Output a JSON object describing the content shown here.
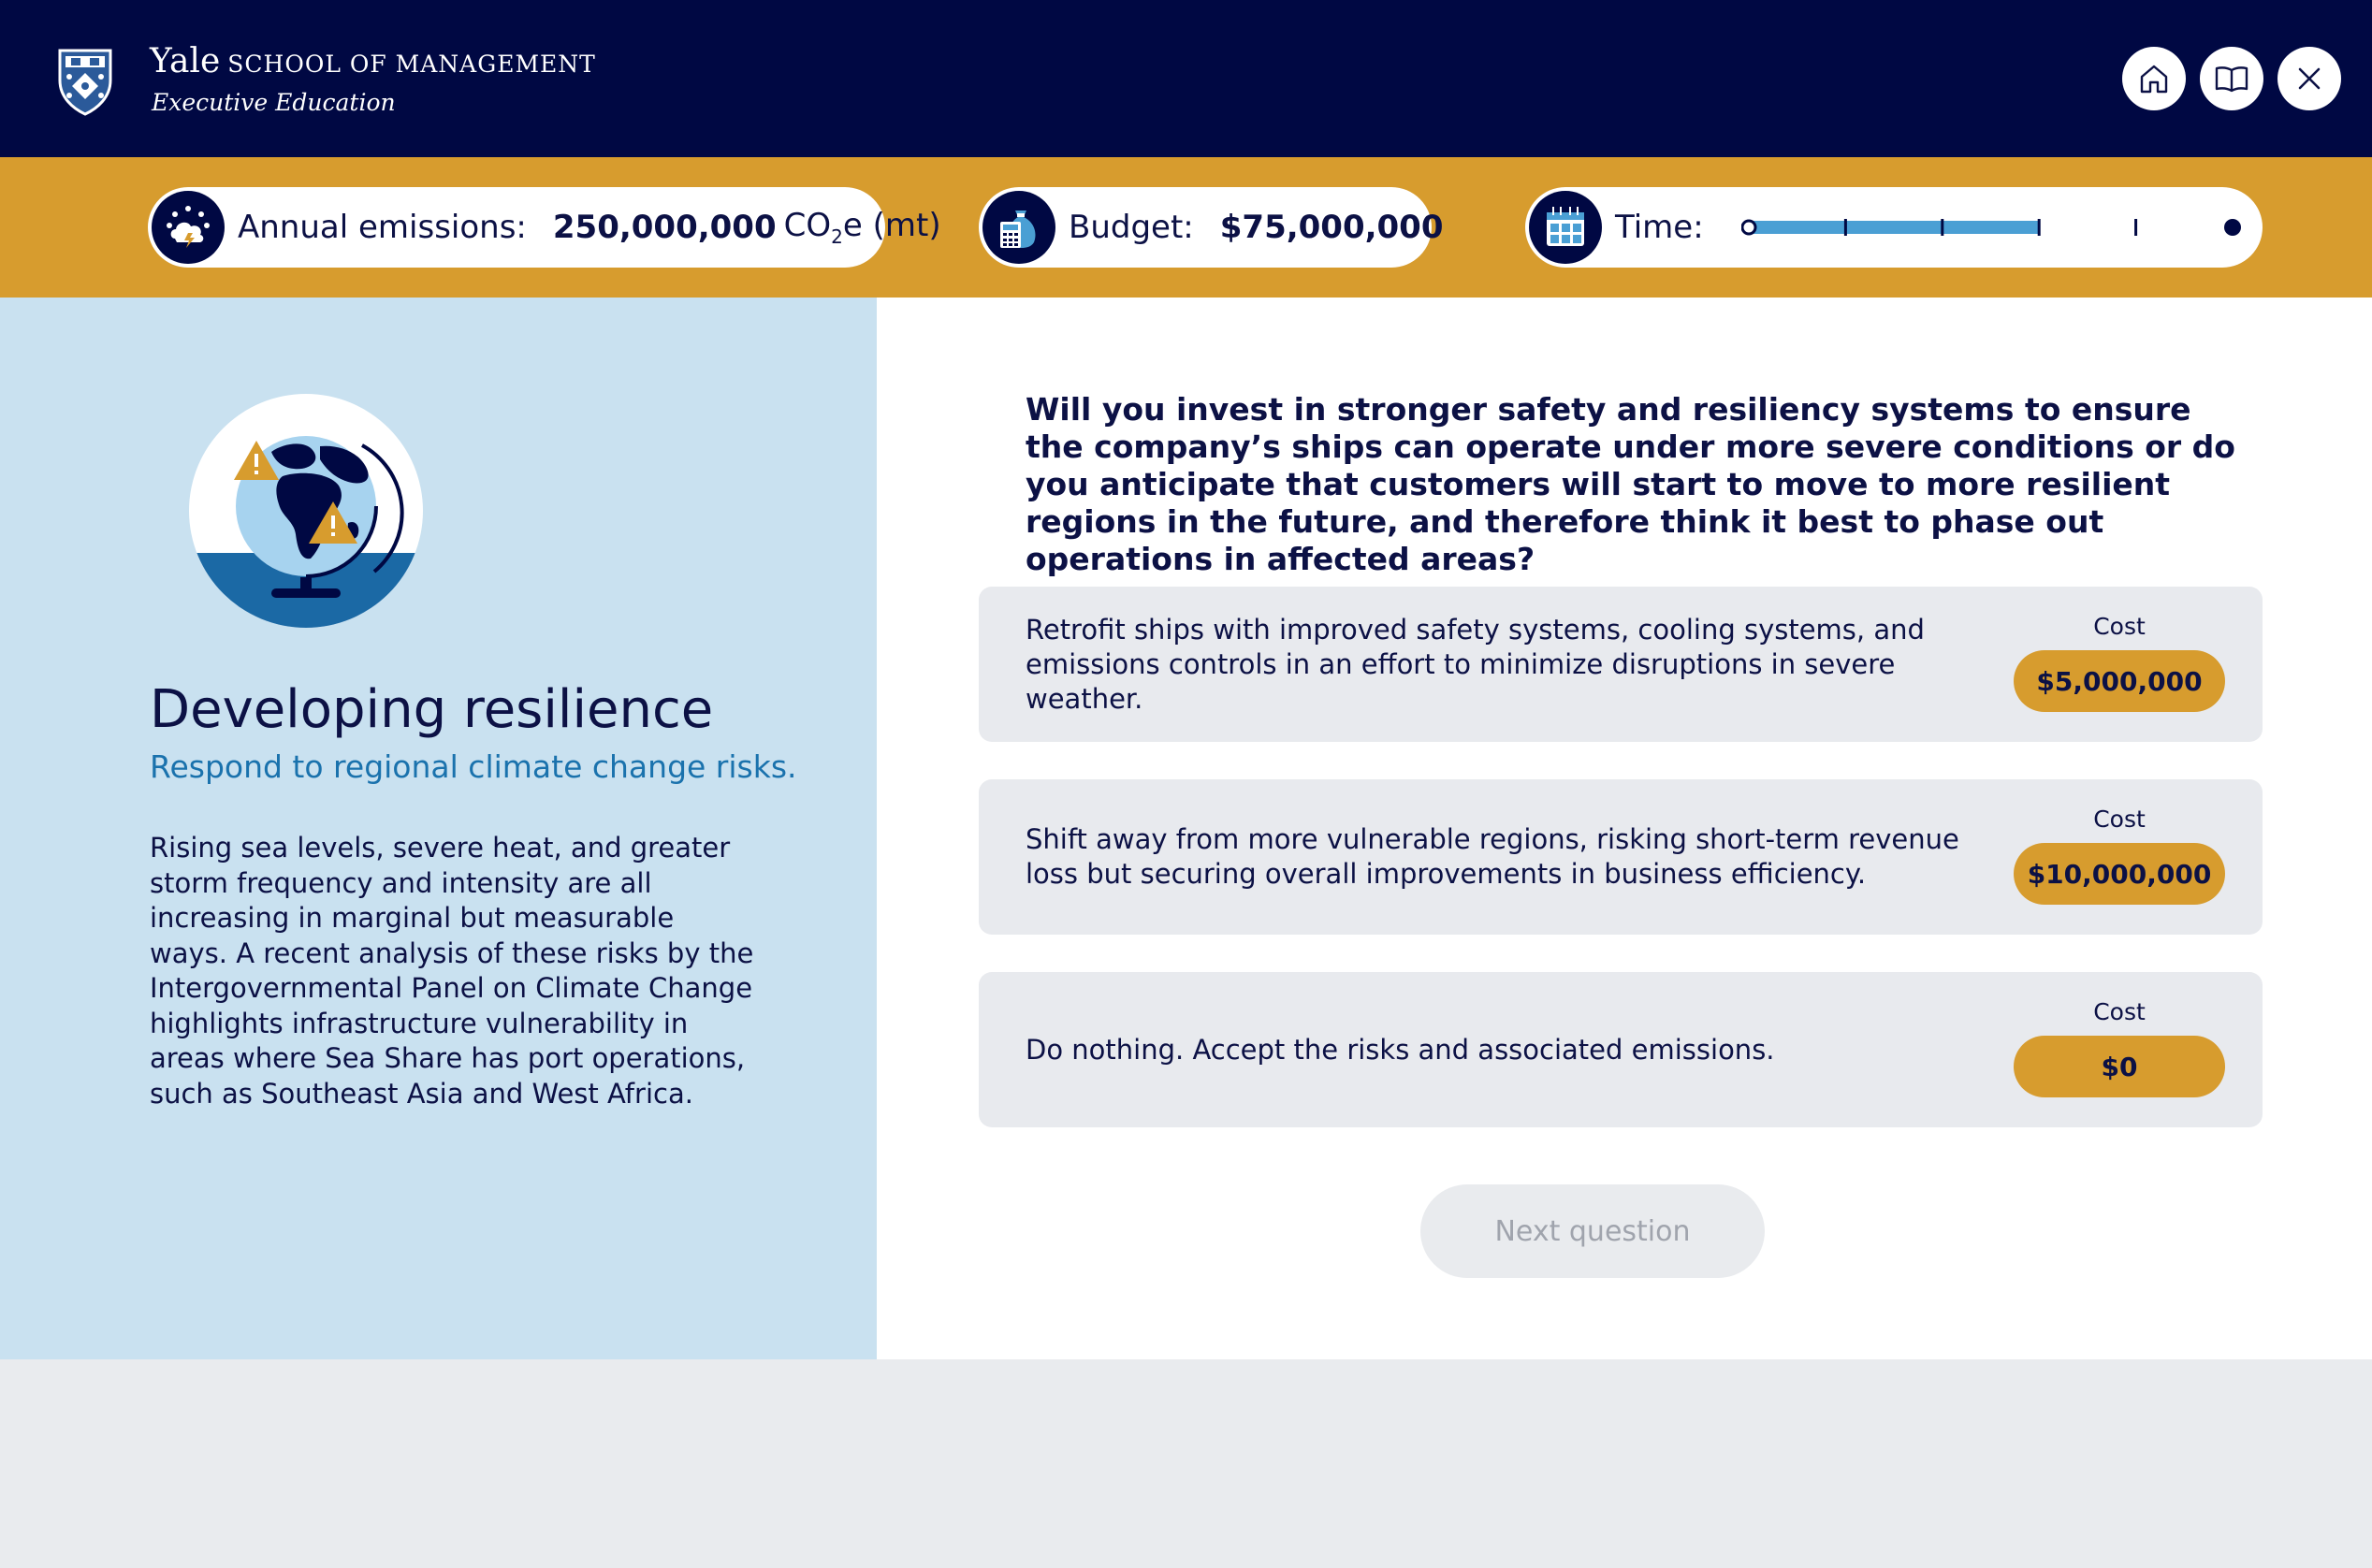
{
  "header": {
    "brand_name": "Yale",
    "brand_school": "SCHOOL OF MANAGEMENT",
    "brand_sub": "Executive Education",
    "icons": [
      "yale-crest-logo",
      "home-icon",
      "book-icon",
      "close-icon"
    ]
  },
  "status": {
    "emissions": {
      "label": "Annual emissions:",
      "value": "250,000,000",
      "unit_pre": "CO",
      "unit_sub": "2",
      "unit_post": "e (mt)",
      "icon": "cloud-warning-icon"
    },
    "budget": {
      "label": "Budget:",
      "value": "$75,000,000",
      "icon": "money-bag-calculator-icon"
    },
    "time": {
      "label": "Time:",
      "icon": "calendar-icon",
      "progress_fraction": 0.6,
      "total_steps": 5,
      "completed_steps": 3
    }
  },
  "section": {
    "title": "Developing resilience",
    "subtitle": "Respond to regional climate change risks.",
    "body": "Rising sea levels, severe heat, and greater storm frequency and intensity are all increasing in marginal but measurable ways. A recent analysis of these risks by the Intergovernmental Panel on Climate Change highlights infrastructure vulnerability in areas where Sea Share has port operations, such as Southeast Asia and West Africa.",
    "illustration": "globe-warning-icon"
  },
  "question": "Will you invest in stronger safety and resiliency systems to ensure the company’s ships can operate under more severe conditions or do you anticipate that customers will start to move to more resilient regions in the future, and therefore think it best to phase out operations in affected areas?",
  "options": [
    {
      "text": "Retrofit ships with improved safety systems, cooling systems, and emissions controls in an effort to minimize disruptions in severe weather.",
      "cost_label": "Cost",
      "cost": "$5,000,000"
    },
    {
      "text": "Shift away from more vulnerable regions, risking short-term revenue loss but securing overall improvements in business efficiency.",
      "cost_label": "Cost",
      "cost": "$10,000,000"
    },
    {
      "text": "Do nothing. Accept the risks and associated emissions.",
      "cost_label": "Cost",
      "cost": "$0"
    }
  ],
  "next_button": {
    "label": "Next question",
    "enabled": false
  },
  "colors": {
    "navy": "#000843",
    "gold": "#d79c2e",
    "light_blue": "#c9e1f0",
    "link_blue": "#1a72ad",
    "progress_blue": "#4a9fd4"
  }
}
